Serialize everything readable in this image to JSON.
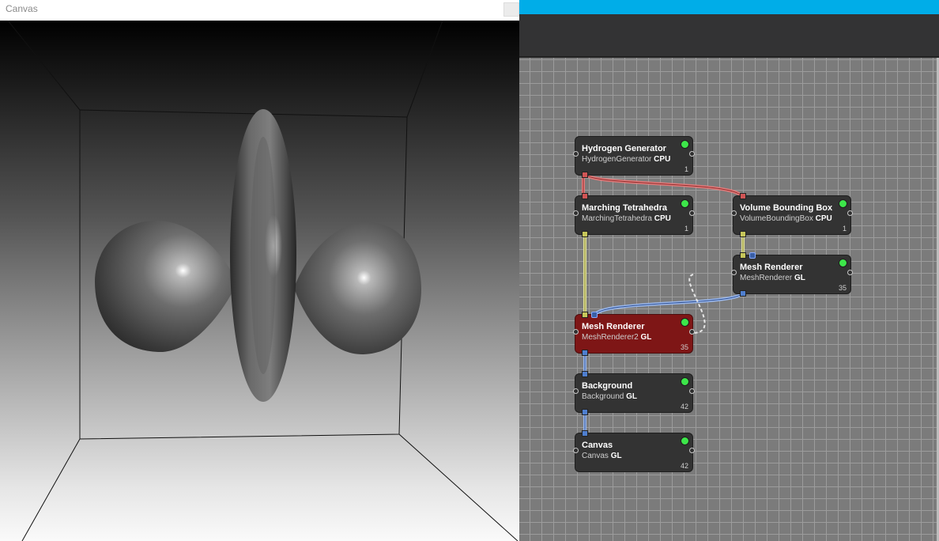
{
  "canvas_window": {
    "title": "Canvas"
  },
  "network": {
    "nodes": [
      {
        "id": "hydrogen-generator",
        "title": "Hydrogen Generator",
        "class": "HydrogenGenerator",
        "tag": "CPU",
        "count": "1",
        "selected": false
      },
      {
        "id": "marching-tetrahedra",
        "title": "Marching Tetrahedra",
        "class": "MarchingTetrahedra",
        "tag": "CPU",
        "count": "1",
        "selected": false
      },
      {
        "id": "volume-bounding-box",
        "title": "Volume Bounding Box",
        "class": "VolumeBoundingBox",
        "tag": "CPU",
        "count": "1",
        "selected": false
      },
      {
        "id": "mesh-renderer-1",
        "title": "Mesh Renderer",
        "class": "MeshRenderer",
        "tag": "GL",
        "count": "35",
        "selected": false
      },
      {
        "id": "mesh-renderer-2",
        "title": "Mesh Renderer",
        "class": "MeshRenderer2",
        "tag": "GL",
        "count": "35",
        "selected": true
      },
      {
        "id": "background",
        "title": "Background",
        "class": "Background",
        "tag": "GL",
        "count": "42",
        "selected": false
      },
      {
        "id": "canvas",
        "title": "Canvas",
        "class": "Canvas",
        "tag": "GL",
        "count": "42",
        "selected": false
      }
    ]
  },
  "colors": {
    "accent": "#00ade8",
    "node_selected": "#7e1616",
    "status_ok": "#3de64a",
    "volume_port": "#d05555",
    "mesh_port": "#c6c65a",
    "image_port": "#4f7fcf"
  }
}
